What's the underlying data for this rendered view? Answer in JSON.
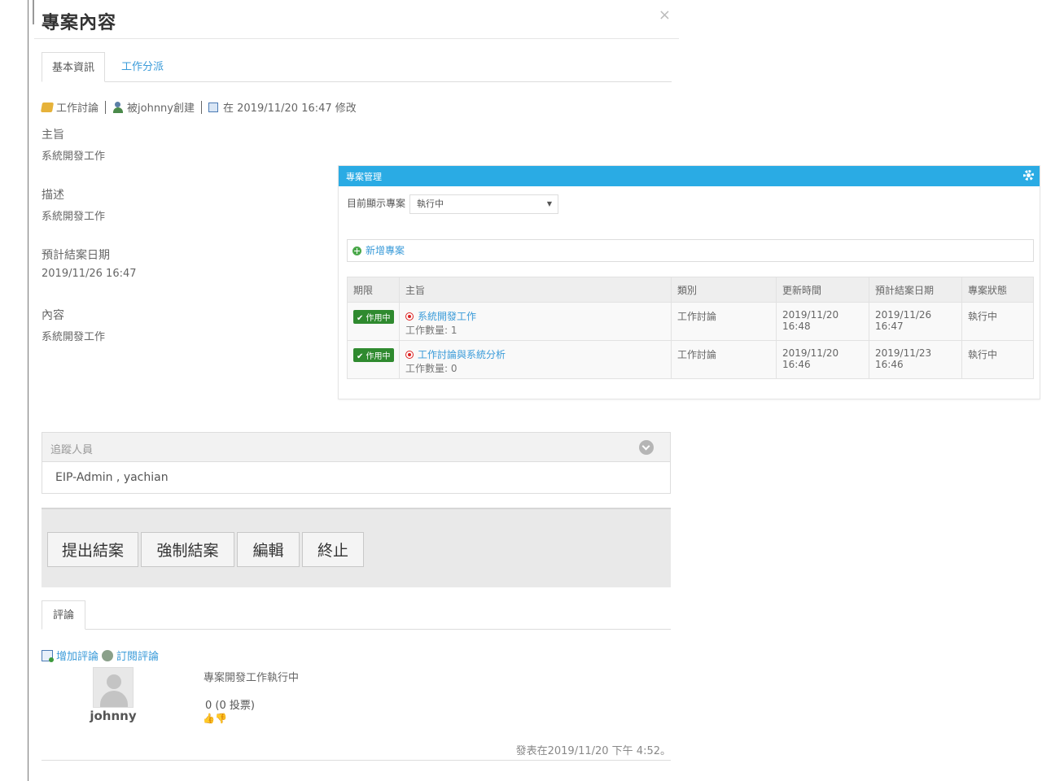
{
  "modal": {
    "title": "專案內容",
    "close": "×",
    "tabs": [
      "基本資訊",
      "工作分派"
    ],
    "meta": {
      "category": "工作討論",
      "creator": "被johnny創建",
      "modified": "在 2019/11/20 16:47 修改"
    },
    "fields": [
      {
        "label": "主旨",
        "value": "系統開發工作"
      },
      {
        "label": "描述",
        "value": "系統開發工作"
      },
      {
        "label": "預計結案日期",
        "value": "2019/11/26 16:47"
      },
      {
        "label": "內容",
        "value": "系統開發工作"
      }
    ],
    "followers": {
      "title": "追蹤人員",
      "value": "EIP-Admin , yachian"
    },
    "actions": [
      "提出結案",
      "強制結案",
      "編輯",
      "終止"
    ],
    "comments": {
      "tab": "評論",
      "add": "增加評論",
      "subscribe": "訂閱評論",
      "author": "johnny",
      "text": "專案開發工作執行中",
      "votes": "0 (0 投票)",
      "thumbs": "👍👎",
      "date": "發表在2019/11/20 下午 4:52。"
    }
  },
  "project_widget": {
    "title": "專案管理",
    "filter_label": "目前顯示專案",
    "filter_value": "執行中",
    "add_label": "新增專案",
    "columns": [
      "期限",
      "主旨",
      "類別",
      "更新時間",
      "預計結案日期",
      "專案狀態"
    ],
    "rows": [
      {
        "badge": "✔ 作用中",
        "subject": "系統開發工作",
        "count": "工作數量: 1",
        "category": "工作討論",
        "updated": "2019/11/20 16:48",
        "due": "2019/11/26 16:47",
        "status": "執行中"
      },
      {
        "badge": "✔ 作用中",
        "subject": "工作討論與系統分析",
        "count": "工作數量: 0",
        "category": "工作討論",
        "updated": "2019/11/20 16:46",
        "due": "2019/11/23 16:46",
        "status": "執行中"
      }
    ]
  },
  "colors": {
    "header_blue": "#2aabe4",
    "link_blue": "#3a9bd9",
    "badge_green": "#2f8a2f"
  }
}
